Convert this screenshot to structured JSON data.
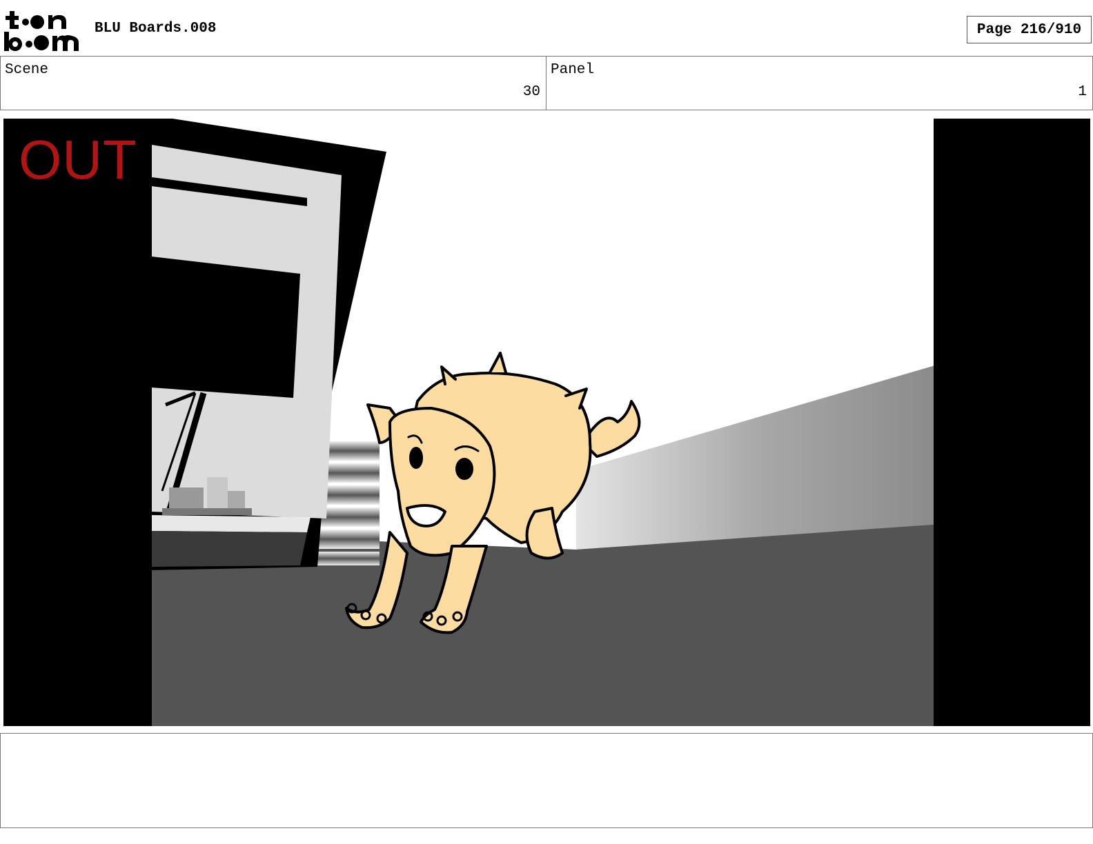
{
  "header": {
    "logo_text": "toon boom",
    "doc_title": "BLU Boards.008",
    "page_indicator": "Page 216/910"
  },
  "info": {
    "scene_label": "Scene",
    "scene_value": "30",
    "panel_label": "Panel",
    "panel_value": "1"
  },
  "panel_image": {
    "overlay_text": "OUT",
    "overlay_color": "#b01414",
    "creature_color": "#fcdca0",
    "floor_color": "#545454"
  },
  "notes": {
    "text": ""
  }
}
